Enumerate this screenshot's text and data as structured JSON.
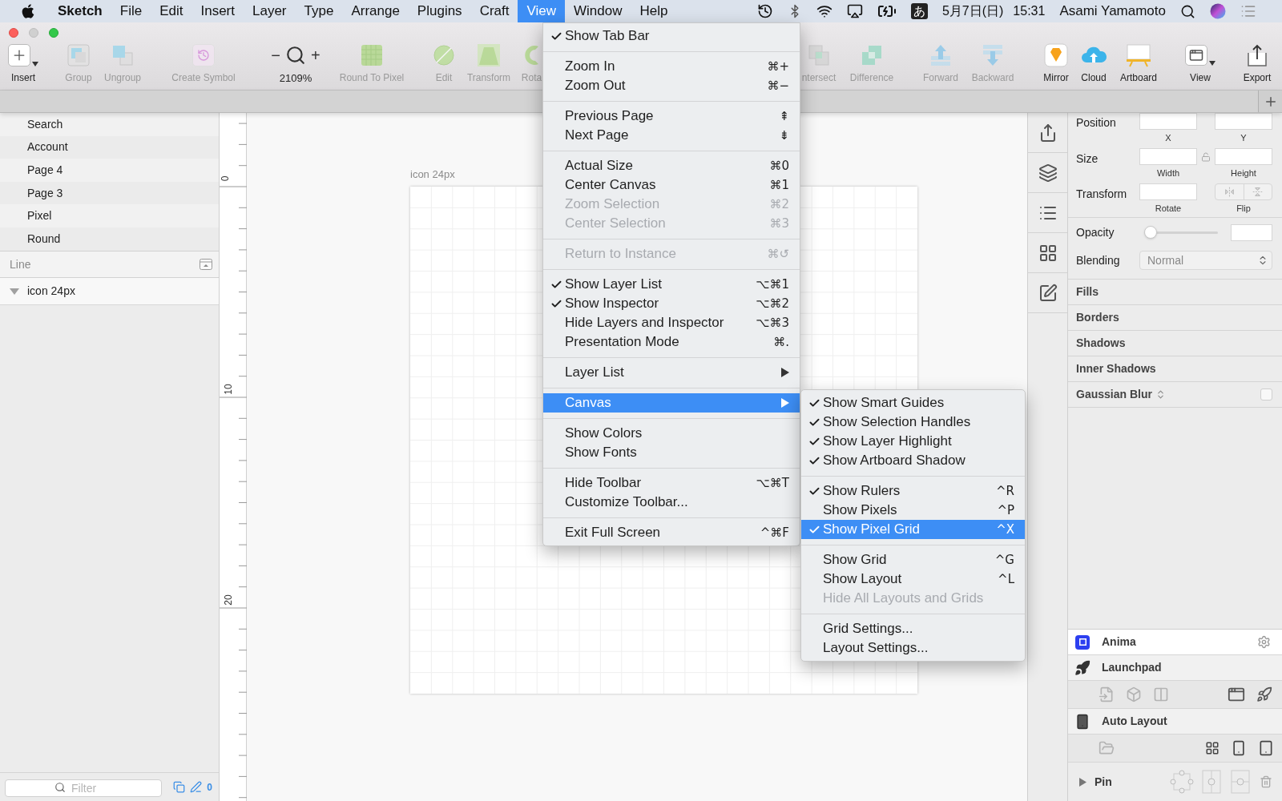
{
  "menubar": {
    "items": [
      {
        "label": "Sketch",
        "kind": "app",
        "selected": false
      },
      {
        "label": "File",
        "kind": "menu",
        "selected": false
      },
      {
        "label": "Edit",
        "kind": "menu",
        "selected": false
      },
      {
        "label": "Insert",
        "kind": "menu",
        "selected": false
      },
      {
        "label": "Layer",
        "kind": "menu",
        "selected": false
      },
      {
        "label": "Type",
        "kind": "menu",
        "selected": false
      },
      {
        "label": "Arrange",
        "kind": "menu",
        "selected": false
      },
      {
        "label": "Plugins",
        "kind": "menu",
        "selected": false
      },
      {
        "label": "Craft",
        "kind": "menu",
        "selected": false
      },
      {
        "label": "View",
        "kind": "menu",
        "selected": true
      },
      {
        "label": "Window",
        "kind": "menu",
        "selected": false
      },
      {
        "label": "Help",
        "kind": "menu",
        "selected": false
      }
    ],
    "input_source": "あ",
    "date": "5月7日(日)",
    "time": "15:31",
    "user": "Asami Yamamoto"
  },
  "toolbar": {
    "items": [
      {
        "label": "Insert",
        "kind": "tool",
        "disabled": false
      },
      {
        "label": "Group",
        "kind": "tool",
        "disabled": true
      },
      {
        "label": "Ungroup",
        "kind": "tool",
        "disabled": true
      },
      {
        "label": "Create Symbol",
        "kind": "tool",
        "disabled": true
      },
      {
        "label": "2109%",
        "kind": "zoom",
        "minus": "−",
        "plus": "+",
        "disabled": false
      },
      {
        "label": "Round To Pixel",
        "kind": "tool",
        "disabled": true
      },
      {
        "label": "Edit",
        "kind": "tool",
        "disabled": true
      },
      {
        "label": "Transform",
        "kind": "tool",
        "disabled": true
      },
      {
        "label": "Rota",
        "kind": "tool",
        "disabled": true
      },
      {
        "label": "ntersect",
        "kind": "tool",
        "disabled": true
      },
      {
        "label": "Difference",
        "kind": "tool",
        "disabled": true
      },
      {
        "label": "Forward",
        "kind": "tool",
        "disabled": true
      },
      {
        "label": "Backward",
        "kind": "tool",
        "disabled": true
      },
      {
        "label": "Mirror",
        "kind": "tool",
        "disabled": false
      },
      {
        "label": "Cloud",
        "kind": "tool",
        "disabled": false
      },
      {
        "label": "Artboard",
        "kind": "tool",
        "disabled": false
      },
      {
        "label": "View",
        "kind": "tool",
        "disabled": false
      },
      {
        "label": "Export",
        "kind": "tool",
        "disabled": false
      }
    ]
  },
  "pages": [
    {
      "label": "Search"
    },
    {
      "label": "Account"
    },
    {
      "label": "Page 4"
    },
    {
      "label": "Page 3"
    },
    {
      "label": "Pixel"
    },
    {
      "label": "Round"
    }
  ],
  "layers": {
    "title": "Line",
    "items": [
      {
        "name": "icon 24px",
        "expanded": true
      }
    ]
  },
  "filter": {
    "placeholder": "Filter",
    "count": "0"
  },
  "ruler": {
    "labels": [
      "0",
      "10",
      "20"
    ]
  },
  "artboard": {
    "name": "icon 24px"
  },
  "view_menu": {
    "groups": [
      [
        {
          "label": "Show Tab Bar",
          "checked": true,
          "disabled": false,
          "selected": false,
          "submenu": false
        }
      ],
      [
        {
          "label": "Zoom In",
          "shortcut": "⌘+",
          "checked": false,
          "disabled": false,
          "selected": false,
          "submenu": false
        },
        {
          "label": "Zoom Out",
          "shortcut": "⌘−",
          "checked": false,
          "disabled": false,
          "selected": false,
          "submenu": false
        }
      ],
      [
        {
          "label": "Previous Page",
          "shortcut": "⇞",
          "checked": false,
          "disabled": false,
          "selected": false,
          "submenu": false
        },
        {
          "label": "Next Page",
          "shortcut": "⇟",
          "checked": false,
          "disabled": false,
          "selected": false,
          "submenu": false
        }
      ],
      [
        {
          "label": "Actual Size",
          "shortcut": "⌘0",
          "checked": false,
          "disabled": false,
          "selected": false,
          "submenu": false
        },
        {
          "label": "Center Canvas",
          "shortcut": "⌘1",
          "checked": false,
          "disabled": false,
          "selected": false,
          "submenu": false
        },
        {
          "label": "Zoom Selection",
          "shortcut": "⌘2",
          "checked": false,
          "disabled": true,
          "selected": false,
          "submenu": false
        },
        {
          "label": "Center Selection",
          "shortcut": "⌘3",
          "checked": false,
          "disabled": true,
          "selected": false,
          "submenu": false
        }
      ],
      [
        {
          "label": "Return to Instance",
          "shortcut": "⌘↺",
          "checked": false,
          "disabled": true,
          "selected": false,
          "submenu": false
        }
      ],
      [
        {
          "label": "Show Layer List",
          "shortcut": "⌥⌘1",
          "checked": true,
          "disabled": false,
          "selected": false,
          "submenu": false
        },
        {
          "label": "Show Inspector",
          "shortcut": "⌥⌘2",
          "checked": true,
          "disabled": false,
          "selected": false,
          "submenu": false
        },
        {
          "label": "Hide Layers and Inspector",
          "shortcut": "⌥⌘3",
          "checked": false,
          "disabled": false,
          "selected": false,
          "submenu": false
        },
        {
          "label": "Presentation Mode",
          "shortcut": "⌘.",
          "checked": false,
          "disabled": false,
          "selected": false,
          "submenu": false
        }
      ],
      [
        {
          "label": "Layer List",
          "checked": false,
          "disabled": false,
          "selected": false,
          "submenu": true
        }
      ],
      [
        {
          "label": "Canvas",
          "checked": false,
          "disabled": false,
          "selected": true,
          "submenu": true
        }
      ],
      [
        {
          "label": "Show Colors",
          "checked": false,
          "disabled": false,
          "selected": false,
          "submenu": false
        },
        {
          "label": "Show Fonts",
          "checked": false,
          "disabled": false,
          "selected": false,
          "submenu": false
        }
      ],
      [
        {
          "label": "Hide Toolbar",
          "shortcut": "⌥⌘T",
          "checked": false,
          "disabled": false,
          "selected": false,
          "submenu": false
        },
        {
          "label": "Customize Toolbar...",
          "checked": false,
          "disabled": false,
          "selected": false,
          "submenu": false
        }
      ],
      [
        {
          "label": "Exit Full Screen",
          "shortcut": "^⌘F",
          "checked": false,
          "disabled": false,
          "selected": false,
          "submenu": false
        }
      ]
    ]
  },
  "canvas_submenu": {
    "groups": [
      [
        {
          "label": "Show Smart Guides",
          "checked": true,
          "disabled": false,
          "selected": false,
          "submenu": false
        },
        {
          "label": "Show Selection Handles",
          "checked": true,
          "disabled": false,
          "selected": false,
          "submenu": false
        },
        {
          "label": "Show Layer Highlight",
          "checked": true,
          "disabled": false,
          "selected": false,
          "submenu": false
        },
        {
          "label": "Show Artboard Shadow",
          "checked": true,
          "disabled": false,
          "selected": false,
          "submenu": false
        }
      ],
      [
        {
          "label": "Show Rulers",
          "shortcut": "^R",
          "checked": true,
          "disabled": false,
          "selected": false,
          "submenu": false
        },
        {
          "label": "Show Pixels",
          "shortcut": "^P",
          "checked": false,
          "disabled": false,
          "selected": false,
          "submenu": false
        },
        {
          "label": "Show Pixel Grid",
          "shortcut": "^X",
          "checked": true,
          "disabled": false,
          "selected": true,
          "submenu": false
        }
      ],
      [
        {
          "label": "Show Grid",
          "shortcut": "^G",
          "checked": false,
          "disabled": false,
          "selected": false,
          "submenu": false
        },
        {
          "label": "Show Layout",
          "shortcut": "^L",
          "checked": false,
          "disabled": false,
          "selected": false,
          "submenu": false
        },
        {
          "label": "Hide All Layouts and Grids",
          "checked": false,
          "disabled": true,
          "selected": false,
          "submenu": false
        }
      ],
      [
        {
          "label": "Grid Settings...",
          "checked": false,
          "disabled": false,
          "selected": false,
          "submenu": false
        },
        {
          "label": "Layout Settings...",
          "checked": false,
          "disabled": false,
          "selected": false,
          "submenu": false
        }
      ]
    ]
  },
  "inspector": {
    "position": {
      "label": "Position",
      "captions": [
        "X",
        "Y"
      ]
    },
    "size": {
      "label": "Size",
      "captions": [
        "Width",
        "Height"
      ],
      "locked": false
    },
    "transform": {
      "label": "Transform",
      "captions": [
        "Rotate",
        "Flip"
      ]
    },
    "opacity": {
      "label": "Opacity",
      "level": 0
    },
    "blending": {
      "label": "Blending",
      "value": "Normal"
    },
    "sections": [
      "Fills",
      "Borders",
      "Shadows",
      "Inner Shadows"
    ],
    "gaussian_blur": {
      "label": "Gaussian Blur",
      "checked": false
    },
    "plugins": [
      {
        "name": "Anima",
        "kind": "anima"
      },
      {
        "name": "Launchpad",
        "kind": "launchpad"
      },
      {
        "name": "Auto Layout",
        "kind": "auto_layout"
      }
    ],
    "pin": {
      "label": "Pin",
      "expanded": false
    }
  }
}
